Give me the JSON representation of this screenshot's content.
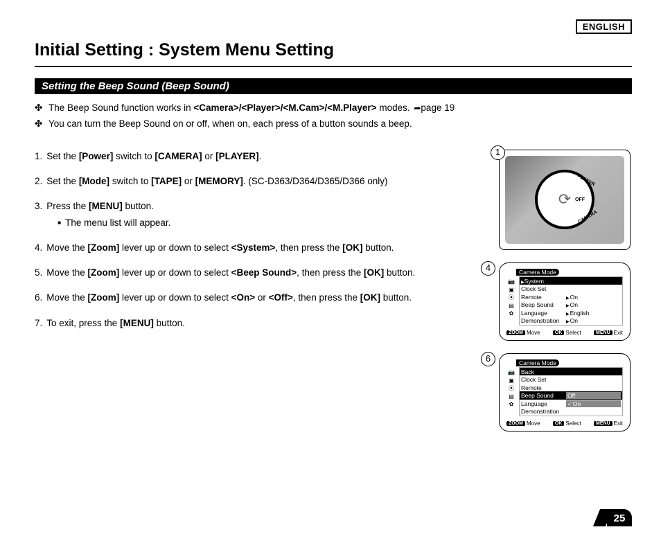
{
  "lang": "ENGLISH",
  "title": "Initial Setting : System Menu Setting",
  "section": "Setting the Beep Sound (Beep Sound)",
  "intro": {
    "l1_pre": "The Beep Sound function works in ",
    "l1_modes": "<Camera>/<Player>/<M.Cam>/<M.Player>",
    "l1_post": " modes. ",
    "l1_page": "page 19",
    "l2": "You can turn the Beep Sound on or off, when on, each press of a button sounds a beep."
  },
  "steps": {
    "s1": {
      "t1": "Set the ",
      "b1": "[Power]",
      "t2": " switch to ",
      "b2": "[CAMERA]",
      "t3": " or ",
      "b3": "[PLAYER]",
      "t4": "."
    },
    "s2": {
      "t1": "Set the ",
      "b1": "[Mode]",
      "t2": " switch to ",
      "b2": "[TAPE]",
      "t3": " or ",
      "b3": "[MEMORY]",
      "t4": ". (SC-D363/D364/D365/D366 only)"
    },
    "s3": {
      "t1": "Press the ",
      "b1": "[MENU]",
      "t2": " button.",
      "sub": "The menu list will appear."
    },
    "s4": {
      "t1": "Move the ",
      "b1": "[Zoom]",
      "t2": " lever up or down to select ",
      "b2": "<System>",
      "t3": ", then press the ",
      "b3": "[OK]",
      "t4": " button."
    },
    "s5": {
      "t1": "Move the ",
      "b1": "[Zoom]",
      "t2": " lever up or down to select ",
      "b2": "<Beep Sound>",
      "t3": ", then press the ",
      "b3": "[OK]",
      "t4": " button."
    },
    "s6": {
      "t1": "Move the ",
      "b1": "[Zoom]",
      "t2": " lever up or down to select ",
      "b2": "<On>",
      "t3": " or ",
      "b3": "<Off>",
      "t4": ", then press the ",
      "b4": "[OK]",
      "t5": " button."
    },
    "s7": {
      "t1": "To exit, press the ",
      "b1": "[MENU]",
      "t2": " button."
    }
  },
  "fig1": {
    "num": "1",
    "label1": "PLAYER",
    "label2": "OFF",
    "label3": "CAMERA"
  },
  "lcd4": {
    "num": "4",
    "title": "Camera Mode",
    "rows": [
      {
        "label": "System",
        "val": "",
        "dark": true,
        "tri": true
      },
      {
        "label": "Clock Set",
        "val": ""
      },
      {
        "label": "Remote",
        "val": "On",
        "tri": true
      },
      {
        "label": "Beep Sound",
        "val": "On",
        "tri": true
      },
      {
        "label": "Language",
        "val": "English",
        "tri": true
      },
      {
        "label": "Demonstration",
        "val": "On",
        "tri": true
      }
    ],
    "foot": {
      "zoom": "ZOOM",
      "move": "Move",
      "ok": "OK",
      "select": "Select",
      "menu": "MENU",
      "exit": "Exit"
    }
  },
  "lcd6": {
    "num": "6",
    "title": "Camera Mode",
    "rows": [
      {
        "label": "Back",
        "val": "",
        "dark": true
      },
      {
        "label": "Clock Set",
        "val": ""
      },
      {
        "label": "Remote",
        "val": ""
      },
      {
        "label": "Beep Sound",
        "val": "Off",
        "dark": true,
        "band": true
      },
      {
        "label": "",
        "val": "On",
        "chk": true,
        "band": true,
        "labalt": "Language"
      },
      {
        "label": "Demonstration",
        "val": ""
      }
    ],
    "foot": {
      "zoom": "ZOOM",
      "move": "Move",
      "ok": "OK",
      "select": "Select",
      "menu": "MENU",
      "exit": "Exit"
    }
  },
  "pageNumber": "25"
}
